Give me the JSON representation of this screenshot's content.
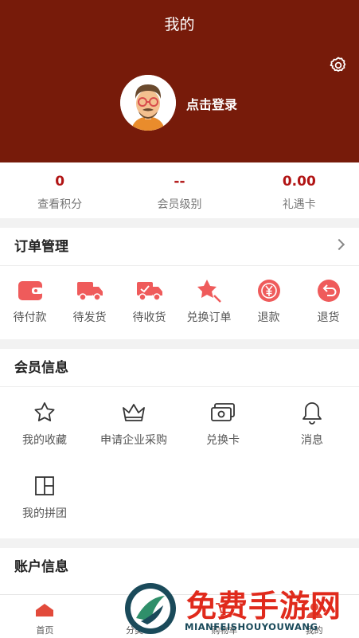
{
  "header": {
    "title": "我的",
    "login_label": "点击登录",
    "icons": [
      "settings-gear-icon",
      "avatar"
    ],
    "bg_color": "#771b0a"
  },
  "stats": [
    {
      "value": "0",
      "label": "查看积分"
    },
    {
      "value": "--",
      "label": "会员级别"
    },
    {
      "value": "0.00",
      "label": "礼遇卡"
    }
  ],
  "orders": {
    "title": "订单管理",
    "items": [
      {
        "label": "待付款",
        "icon": "wallet-icon"
      },
      {
        "label": "待发货",
        "icon": "truck-icon"
      },
      {
        "label": "待收货",
        "icon": "truck-delivery-icon"
      },
      {
        "label": "兑换订单",
        "icon": "star-exchange-icon"
      },
      {
        "label": "退款",
        "icon": "yen-refund-icon"
      },
      {
        "label": "退货",
        "icon": "return-icon"
      }
    ]
  },
  "member": {
    "title": "会员信息",
    "items": [
      {
        "label": "我的收藏",
        "icon": "star-outline-icon"
      },
      {
        "label": "申请企业采购",
        "icon": "crown-icon"
      },
      {
        "label": "兑换卡",
        "icon": "card-icon"
      },
      {
        "label": "消息",
        "icon": "bell-icon"
      },
      {
        "label": "我的拼团",
        "icon": "layout-icon"
      }
    ]
  },
  "account": {
    "title": "账户信息"
  },
  "tabbar": [
    {
      "label": "首页",
      "icon": "home-icon"
    },
    {
      "label": "分类",
      "icon": "category-icon"
    },
    {
      "label": "购物车",
      "icon": "cart-icon"
    },
    {
      "label": "我的",
      "icon": "user-icon"
    }
  ],
  "watermark": {
    "title": "免费手游网",
    "subtitle": "MIANFEISHOUYOUWANG"
  },
  "colors": {
    "accent": "#b11414",
    "order_icon": "#ef5b5b",
    "watermark": "#e02a1c"
  }
}
